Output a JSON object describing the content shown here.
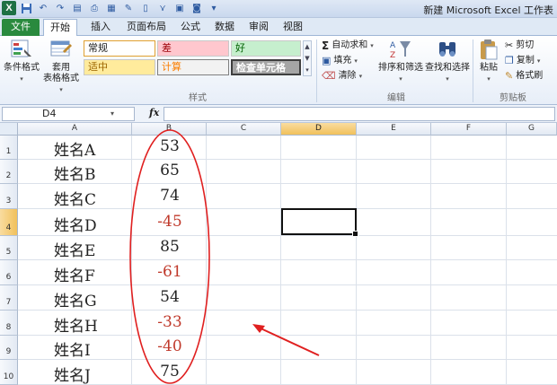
{
  "window": {
    "title": "新建 Microsoft Excel 工作表"
  },
  "tabs": [
    "文件",
    "开始",
    "插入",
    "页面布局",
    "公式",
    "数据",
    "审阅",
    "视图"
  ],
  "ribbon": {
    "conditional_format": "条件格式",
    "format_table_line1": "套用",
    "format_table_line2": "表格格式",
    "styles_group": "样式",
    "styles": {
      "normal": "常规",
      "bad": "差",
      "good": "好",
      "neutral": "适中",
      "calc": "计算",
      "check": "检查单元格"
    },
    "autosum": "自动求和",
    "fill": "填充",
    "clear": "清除",
    "sort_filter": "排序和筛选",
    "find_select": "查找和选择",
    "editing_group": "编辑",
    "paste": "粘贴",
    "cut": "剪切",
    "copy": "复制",
    "format_painter": "格式刷",
    "clipboard_group": "剪贴板"
  },
  "formula_bar": {
    "name_box": "D4",
    "fx": "fx",
    "formula": ""
  },
  "columns": [
    "A",
    "B",
    "C",
    "D",
    "E",
    "F",
    "G"
  ],
  "rows": [
    "1",
    "2",
    "3",
    "4",
    "5",
    "6",
    "7",
    "8",
    "9",
    "10"
  ],
  "cells": [
    {
      "a": "姓名A",
      "b": "53",
      "neg": false
    },
    {
      "a": "姓名B",
      "b": "65",
      "neg": false
    },
    {
      "a": "姓名C",
      "b": "74",
      "neg": false
    },
    {
      "a": "姓名D",
      "b": "-45",
      "neg": true
    },
    {
      "a": "姓名E",
      "b": "85",
      "neg": false
    },
    {
      "a": "姓名F",
      "b": "-61",
      "neg": true
    },
    {
      "a": "姓名G",
      "b": "54",
      "neg": false
    },
    {
      "a": "姓名H",
      "b": "-33",
      "neg": true
    },
    {
      "a": "姓名I",
      "b": "-40",
      "neg": true
    },
    {
      "a": "姓名J",
      "b": "75",
      "neg": false
    }
  ],
  "colors": {
    "negative": "#c0392b",
    "annotation": "#e02020",
    "accent": "#2a8a3e"
  },
  "selected": {
    "column": "D",
    "row": "4"
  }
}
